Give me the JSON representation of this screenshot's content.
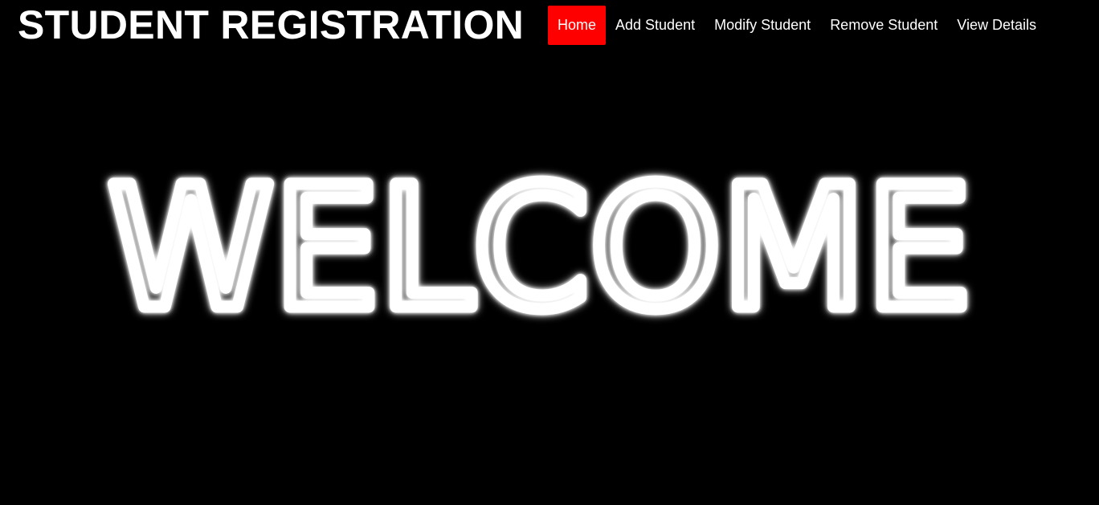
{
  "header": {
    "title": "STUDENT REGISTRATION"
  },
  "nav": {
    "items": [
      {
        "label": "Home",
        "active": true
      },
      {
        "label": "Add Student",
        "active": false
      },
      {
        "label": "Modify Student",
        "active": false
      },
      {
        "label": "Remove Student",
        "active": false
      },
      {
        "label": "View Details",
        "active": false
      }
    ]
  },
  "hero": {
    "text": "WELCOME"
  },
  "colors": {
    "background": "#000000",
    "text": "#ffffff",
    "active_nav": "#ff0000",
    "glow": "#ffffff"
  }
}
